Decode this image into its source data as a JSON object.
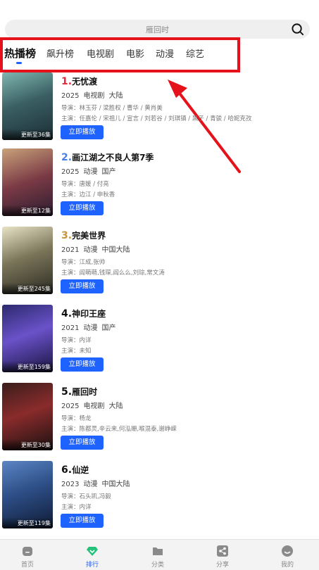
{
  "search": {
    "placeholder_text": "雁回时"
  },
  "tabs": [
    "热播榜",
    "飙升榜",
    "电视剧",
    "电影",
    "动漫",
    "综艺"
  ],
  "colors": {
    "accent": "#1e62ff",
    "highlight": "#e6121b",
    "rank_red": "#e8273b",
    "rank_blue": "#4a7fe6",
    "rank_gold": "#c79440"
  },
  "items": [
    {
      "rank": "1.",
      "name": "无忧渡",
      "year": "2025",
      "type": "电视剧",
      "region": "大陆",
      "director": "导演：林玉芬 / 梁胜权 / 曹华 / 黄肖美",
      "cast": "主演：任嘉伦 / 宋祖儿 / 宣言 / 刘若谷 / 刘琪镇 / 黑子 / 青骏 / 哈妮克孜",
      "badge": "更新至36集",
      "play": "立即播放"
    },
    {
      "rank": "2.",
      "name": "画江湖之不良人第7季",
      "year": "2025",
      "type": "动漫",
      "region": "国产",
      "director": "导演：唐媛 / 付亮",
      "cast": "主演：边江 / 申秋香",
      "badge": "更新至12集",
      "play": "立即播放"
    },
    {
      "rank": "3.",
      "name": "完美世界",
      "year": "2021",
      "type": "动漫",
      "region": "中国大陆",
      "director": "导演：江成,张帅",
      "cast": "主演：阎萌萌,钱琛,阎么么,刘琮,常文涛",
      "badge": "更新至245集",
      "play": "立即播放"
    },
    {
      "rank": "4.",
      "name": "神印王座",
      "year": "2021",
      "type": "动漫",
      "region": "国产",
      "director": "导演：内详",
      "cast": "主演：未知",
      "badge": "更新至159集",
      "play": "立即播放"
    },
    {
      "rank": "5.",
      "name": "雁回时",
      "year": "2025",
      "type": "电视剧",
      "region": "大陆",
      "director": "导演：杨龙",
      "cast": "主演：陈都灵,辛云来,何泓姗,喉混泰,谢峥嵘",
      "badge": "更新至30集",
      "play": "立即播放"
    },
    {
      "rank": "6.",
      "name": "仙逆",
      "year": "2023",
      "type": "动漫",
      "region": "中国大陆",
      "director": "导演：石头凯,冯毅",
      "cast": "主演：内详",
      "badge": "更新至119集",
      "play": "立即播放"
    }
  ],
  "nav": [
    "首页",
    "排行",
    "分类",
    "分享",
    "我的"
  ]
}
